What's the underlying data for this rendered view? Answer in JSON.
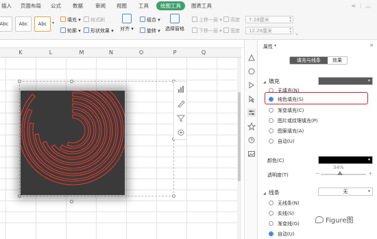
{
  "menu": {
    "tabs": [
      "插入",
      "页面布局",
      "公式",
      "数据",
      "审阅",
      "视图",
      "工具",
      "绘图工具",
      "图表工具"
    ],
    "active_tab": "绘图工具"
  },
  "ribbon": {
    "style_samples": [
      "Abc",
      "Abc",
      "Abc"
    ],
    "fill_label": "填充",
    "format_painter_label": "格式刷",
    "outline_label": "轮廓",
    "shape_effects_label": "形状效果",
    "align_label": "对齐",
    "group_label": "组合",
    "rotate_label": "旋转",
    "select_pane_label": "选择窗格",
    "bring_forward_label": "上移一层",
    "send_backward_label": "下移一层",
    "height_label": "高度",
    "width_label": "宽度",
    "height_value": "7.28厘米",
    "width_value": "12.28厘米"
  },
  "grid": {
    "columns": [
      "K",
      "L",
      "M",
      "N",
      "O",
      "P",
      "Q"
    ]
  },
  "chart": {
    "arc_color": "#e8392e",
    "background_color": "#3a3a3a"
  },
  "panel": {
    "title": "属性",
    "tabs": [
      "填充与线条",
      "效果"
    ],
    "active_tab": "填充与线条",
    "fill_section": {
      "title": "填充",
      "swatch_color": "#5a5a5a",
      "options": [
        "无填充(N)",
        "纯色填充(S)",
        "渐变填充(C)",
        "图片或纹理填充(P)",
        "图案填充(A)",
        "自动(U)"
      ],
      "selected": "纯色填充(S)"
    },
    "color_label": "颜色(C)",
    "color_value": "#000000",
    "transparency_label": "透明度(T)",
    "transparency_value": "34%",
    "transparency_fraction": 0.34,
    "line_section": {
      "title": "线条",
      "dropdown_value": "无",
      "options": [
        "无线条(N)",
        "实线(S)",
        "渐变线(G)",
        "自动(U)"
      ],
      "selected": "自动(U)"
    }
  },
  "watermark": "Figure图"
}
